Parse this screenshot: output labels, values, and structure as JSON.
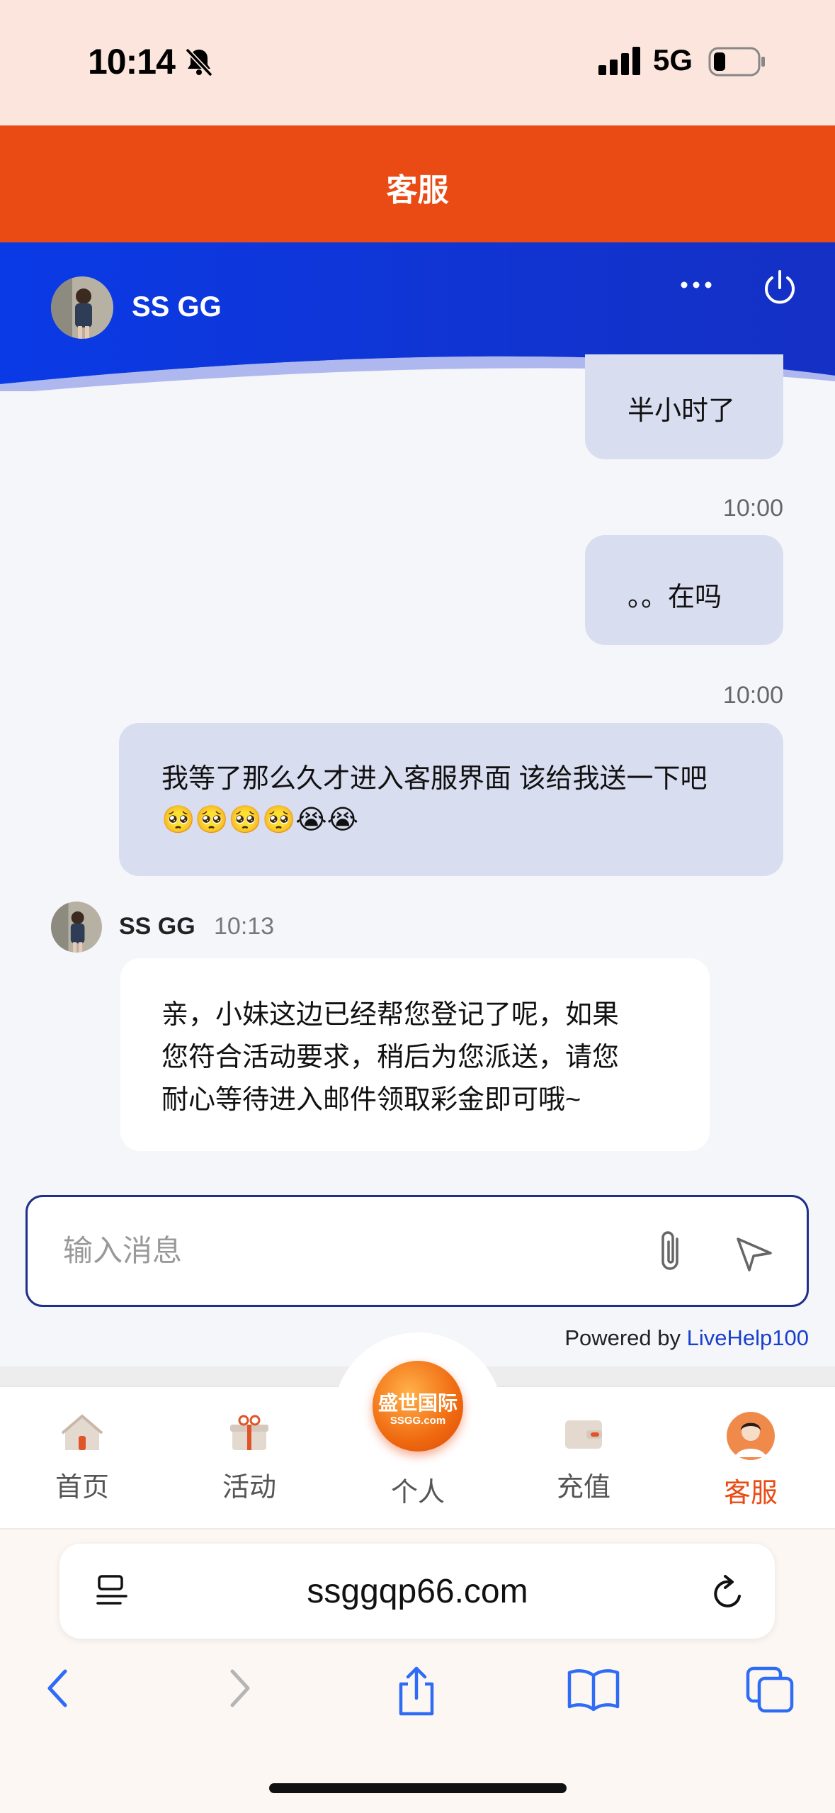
{
  "status_bar": {
    "time": "10:14",
    "network": "5G"
  },
  "header": {
    "title": "客服"
  },
  "agent": {
    "name": "SS GG"
  },
  "messages": [
    {
      "side": "right",
      "text": "半小时了"
    },
    {
      "time": "10:00"
    },
    {
      "side": "right",
      "text": "。。在吗"
    },
    {
      "time": "10:00"
    },
    {
      "side": "right",
      "text": "我等了那么久才进入客服界面 该给我送一下吧",
      "emoji": "🥺🥺🥺🥺😭😭"
    },
    {
      "side": "left",
      "sender": "SS GG",
      "time": "10:13",
      "lines": [
        "亲，小妹这边已经帮您登记了呢，如果",
        "您符合活动要求，稍后为您派送，请您",
        "耐心等待进入邮件领取彩金即可哦~"
      ]
    }
  ],
  "input": {
    "placeholder": "输入消息"
  },
  "powered_by": {
    "prefix": "Powered by ",
    "link": "LiveHelp100"
  },
  "nav": {
    "items": [
      "首页",
      "活动",
      "个人",
      "充值",
      "客服"
    ],
    "logo_text": "盛世国际",
    "logo_sub": "SSGG.com",
    "active": "客服"
  },
  "browser": {
    "url": "ssggqp66.com"
  },
  "colors": {
    "header": "#ea4b14",
    "agent_bar": "#0b33d8",
    "accent": "#ea4b14",
    "bubble_right": "#d9ddf0"
  }
}
